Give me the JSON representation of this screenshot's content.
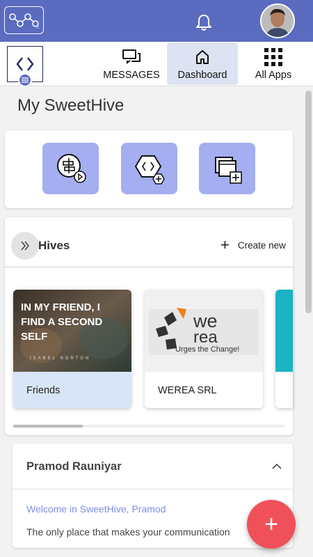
{
  "header": {
    "logo_icon": "hive-network-logo",
    "bell_icon": "bell-icon",
    "avatar": "user-avatar"
  },
  "nav": {
    "tabs": [
      {
        "label": "MESSAGES",
        "icon": "chat-bubbles-icon"
      },
      {
        "label": "Dashboard",
        "icon": "home-icon",
        "active": true
      },
      {
        "label": "All Apps",
        "icon": "grid-icon"
      }
    ]
  },
  "page": {
    "title": "My SweetHive"
  },
  "quick_actions": [
    "chat-add-icon",
    "hive-add-icon",
    "window-add-icon"
  ],
  "hives": {
    "title": "Hives",
    "create_label": "Create new",
    "items": [
      {
        "label": "Friends",
        "image_text": [
          "IN MY FRIEND, I",
          "FIND A SECOND",
          "SELF"
        ],
        "image_caption": "ISABEL NORTON"
      },
      {
        "label": "WEREA SRL",
        "image_text": [
          "we",
          "rea"
        ],
        "image_caption": "Urges the Change!"
      }
    ]
  },
  "profile": {
    "name": "Pramod Rauniyar",
    "welcome": "Welcome in SweetHive, Pramod",
    "description": "The only place that makes your communication"
  },
  "fab": {
    "label": "+"
  },
  "colors": {
    "primary": "#5b6bc0",
    "accent": "#a4aef0",
    "fab": "#f0505a",
    "teal": "#1ab3c4"
  }
}
